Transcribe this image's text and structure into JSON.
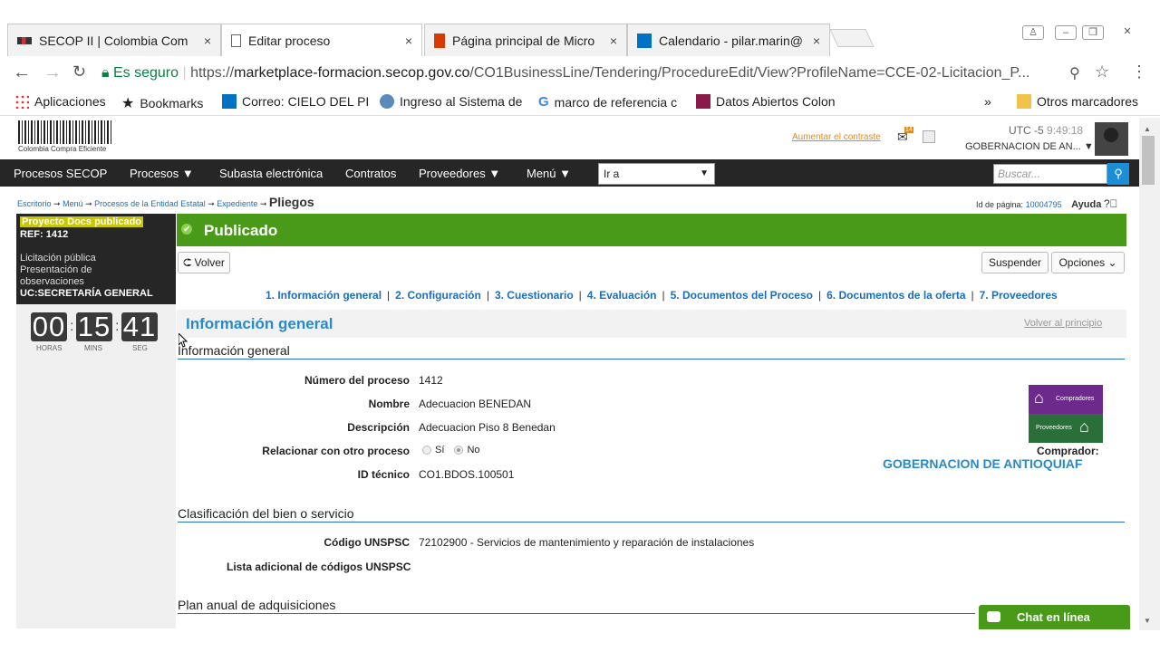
{
  "browser": {
    "tabs": [
      {
        "title": "SECOP II | Colombia Com",
        "close": "×"
      },
      {
        "title": "Editar proceso",
        "close": "×"
      },
      {
        "title": "Página principal de Micro",
        "close": "×"
      },
      {
        "title": "Calendario - pilar.marin@",
        "close": "×"
      }
    ],
    "url": {
      "secure_label": "Es seguro",
      "scheme": "https://",
      "host": "marketplace-formacion.secop.gov.co",
      "path": "/CO1BusinessLine/Tendering/ProcedureEdit/View?ProfileName=CCE-02-Licitacion_P..."
    },
    "bookmarks": [
      {
        "label": "Aplicaciones"
      },
      {
        "label": "Bookmarks"
      },
      {
        "label": "Correo: CIELO DEL PI"
      },
      {
        "label": "Ingreso al Sistema de"
      },
      {
        "label": "marco de referencia c"
      },
      {
        "label": "Datos Abiertos Colon"
      }
    ],
    "more_bookmarks": "»",
    "other_bookmarks": "Otros marcadores"
  },
  "header": {
    "logo_text": "Colombia Compra Eficiente",
    "contrast_link": "Aumentar el contraste",
    "mail_count": "14",
    "utc": "UTC -5",
    "time": "9:49:18",
    "entity": "GOBERNACION DE AN..."
  },
  "nav": {
    "items": [
      "Procesos SECOP",
      "Procesos",
      "Subasta electrónica",
      "Contratos",
      "Proveedores",
      "Menú"
    ],
    "goto_value": "Ir a",
    "search_placeholder": "Buscar..."
  },
  "breadcrumb": {
    "items": [
      "Escritorio",
      "Menú",
      "Procesos de la Entidad Estatal",
      "Expediente"
    ],
    "current": "Pliegos",
    "page_id_label": "Id de página:",
    "page_id": "10004795",
    "help": "Ayuda"
  },
  "left_panel": {
    "badge": "Proyecto Docs publicado",
    "ref": "REF: 1412",
    "type_lines": [
      "Licitación pública",
      "Presentación de",
      "observaciones"
    ],
    "unit": "UC:SECRETARÍA GENERAL",
    "clock": {
      "hours": "00",
      "mins": "15",
      "secs": "41",
      "hours_label": "HORAS",
      "mins_label": "MINS",
      "secs_label": "SEG"
    }
  },
  "status": {
    "label": "Publicado"
  },
  "actions": {
    "back": "Volver",
    "suspend": "Suspender",
    "options": "Opciones"
  },
  "sections": [
    "1. Información general",
    "2. Configuración",
    "3. Cuestionario",
    "4. Evaluación",
    "5. Documentos del Proceso",
    "6. Documentos de la oferta",
    "7. Proveedores"
  ],
  "info": {
    "title": "Información general",
    "back_to_top": "Volver al principio",
    "subhead": "Información general",
    "fields": [
      {
        "label": "Número del proceso",
        "value": "1412"
      },
      {
        "label": "Nombre",
        "value": "Adecuacion BENEDAN"
      },
      {
        "label": "Descripción",
        "value": "Adecuacion Piso 8 Benedan"
      },
      {
        "label": "Relacionar con otro proceso",
        "value": ""
      },
      {
        "label": "ID técnico",
        "value": "CO1.BDOS.100501"
      }
    ],
    "radio_yes": "Sí",
    "radio_no": "No",
    "buyer_logo_top": "Compradores",
    "buyer_logo_bottom": "Proveedores",
    "buyer_label": "Comprador:",
    "buyer_name": "GOBERNACION DE ANTIOQUIAF"
  },
  "classification": {
    "subhead": "Clasificación del bien o servicio",
    "unspsc_label": "Código UNSPSC",
    "unspsc_value": "72102900 - Servicios de mantenimiento y reparación de instalaciones",
    "additional_label": "Lista adicional de códigos UNSPSC"
  },
  "plan": {
    "subhead": "Plan anual de adquisiciones"
  },
  "chat": {
    "label": "Chat en línea"
  }
}
